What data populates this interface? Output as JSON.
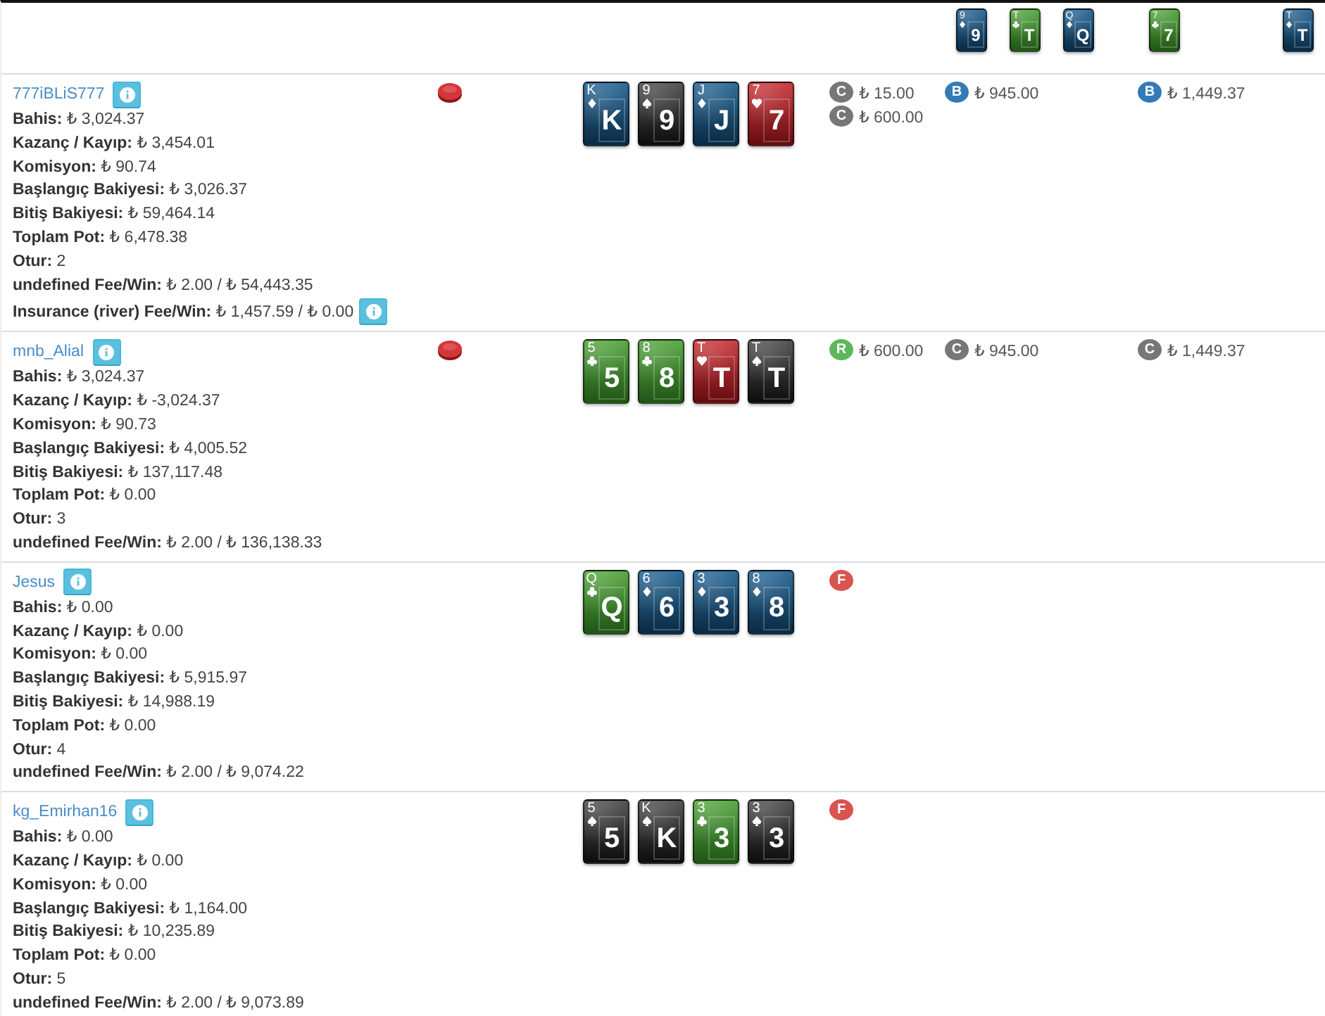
{
  "board": {
    "column_5": [
      {
        "index": "9",
        "kind": "diamonds",
        "rank": "9"
      },
      {
        "index": "T",
        "kind": "clubs",
        "rank": "T"
      },
      {
        "index": "Q",
        "kind": "diamonds",
        "rank": "Q"
      }
    ],
    "column_6": [
      {
        "index": "7",
        "kind": "clubs",
        "rank": "7"
      }
    ],
    "column_7": [
      {
        "index": "T",
        "kind": "diamonds",
        "rank": "T"
      }
    ]
  },
  "players": [
    {
      "name": "777iBLiS777",
      "chip": true,
      "cards": [
        {
          "index": "K",
          "kind": "diamonds",
          "rank": "K"
        },
        {
          "index": "9",
          "kind": "spades",
          "rank": "9"
        },
        {
          "index": "J",
          "kind": "diamonds",
          "rank": "J"
        },
        {
          "index": "7",
          "kind": "hearts",
          "rank": "7"
        }
      ],
      "stats": [
        "**Bahis:** ₺ 3,024.37",
        "**Kazanç / Kayıp:** ₺ 3,454.01",
        "**Komisyon:** ₺ 90.74",
        "**Başlangıç Bakiyesi:** ₺ 3,026.37",
        "**Bitiş Bakiyesi:** ₺ 59,464.14",
        "**Toplam Pot:** ₺ 6,478.38",
        "**Otur:** 2",
        "**undefined Fee/Win:** ₺ 2.00 / ₺ 54,443.35"
      ],
      "insurance": "**Insurance (river) Fee/Win:** ₺ 1,457.59 / ₺ 0.00",
      "column_4": [
        {
          "kind": "call",
          "letter": "C",
          "amount": "₺ 15.00"
        },
        {
          "kind": "call",
          "letter": "C",
          "amount": "₺ 600.00"
        }
      ],
      "column_5": [
        {
          "kind": "bet",
          "letter": "B",
          "amount": "₺ 945.00"
        }
      ],
      "column_6": [
        {
          "kind": "bet",
          "letter": "B",
          "amount": "₺ 1,449.37"
        }
      ]
    },
    {
      "name": "mnb_Alial",
      "chip": true,
      "cards": [
        {
          "index": "5",
          "kind": "clubs",
          "rank": "5"
        },
        {
          "index": "8",
          "kind": "clubs",
          "rank": "8"
        },
        {
          "index": "T",
          "kind": "hearts",
          "rank": "T"
        },
        {
          "index": "T",
          "kind": "spades",
          "rank": "T"
        }
      ],
      "stats": [
        "**Bahis:** ₺ 3,024.37",
        "**Kazanç / Kayıp:** ₺ -3,024.37",
        "**Komisyon:** ₺ 90.73",
        "**Başlangıç Bakiyesi:** ₺ 4,005.52",
        "**Bitiş Bakiyesi:** ₺ 137,117.48",
        "**Toplam Pot:** ₺ 0.00",
        "**Otur:** 3",
        "**undefined Fee/Win:** ₺ 2.00 / ₺ 136,138.33"
      ],
      "column_4": [
        {
          "kind": "raise",
          "letter": "R",
          "amount": "₺ 600.00"
        }
      ],
      "column_5": [
        {
          "kind": "call",
          "letter": "C",
          "amount": "₺ 945.00"
        }
      ],
      "column_6": [
        {
          "kind": "call",
          "letter": "C",
          "amount": "₺ 1,449.37"
        }
      ]
    },
    {
      "name": "Jesus",
      "chip": false,
      "cards": [
        {
          "index": "Q",
          "kind": "clubs",
          "rank": "Q"
        },
        {
          "index": "6",
          "kind": "diamonds",
          "rank": "6"
        },
        {
          "index": "3",
          "kind": "diamonds",
          "rank": "3"
        },
        {
          "index": "8",
          "kind": "diamonds",
          "rank": "8"
        }
      ],
      "stats": [
        "**Bahis:** ₺ 0.00",
        "**Kazanç / Kayıp:** ₺ 0.00",
        "**Komisyon:** ₺ 0.00",
        "**Başlangıç Bakiyesi:** ₺ 5,915.97",
        "**Bitiş Bakiyesi:** ₺ 14,988.19",
        "**Toplam Pot:** ₺ 0.00",
        "**Otur:** 4",
        "**undefined Fee/Win:** ₺ 2.00 / ₺ 9,074.22"
      ],
      "column_4": [
        {
          "kind": "fold",
          "letter": "F"
        }
      ]
    },
    {
      "name": "kg_Emirhan16",
      "chip": false,
      "cards": [
        {
          "index": "5",
          "kind": "spades",
          "rank": "5"
        },
        {
          "index": "K",
          "kind": "spades",
          "rank": "K"
        },
        {
          "index": "3",
          "kind": "clubs",
          "rank": "3"
        },
        {
          "index": "3",
          "kind": "spades",
          "rank": "3"
        }
      ],
      "stats": [
        "**Bahis:** ₺ 0.00",
        "**Kazanç / Kayıp:** ₺ 0.00",
        "**Komisyon:** ₺ 0.00",
        "**Başlangıç Bakiyesi:** ₺ 1,164.00",
        "**Bitiş Bakiyesi:** ₺ 10,235.89",
        "**Toplam Pot:** ₺ 0.00",
        "**Otur:** 5",
        "**undefined Fee/Win:** ₺ 2.00 / ₺ 9,073.89"
      ],
      "column_4": [
        {
          "kind": "fold",
          "letter": "F"
        }
      ]
    }
  ]
}
